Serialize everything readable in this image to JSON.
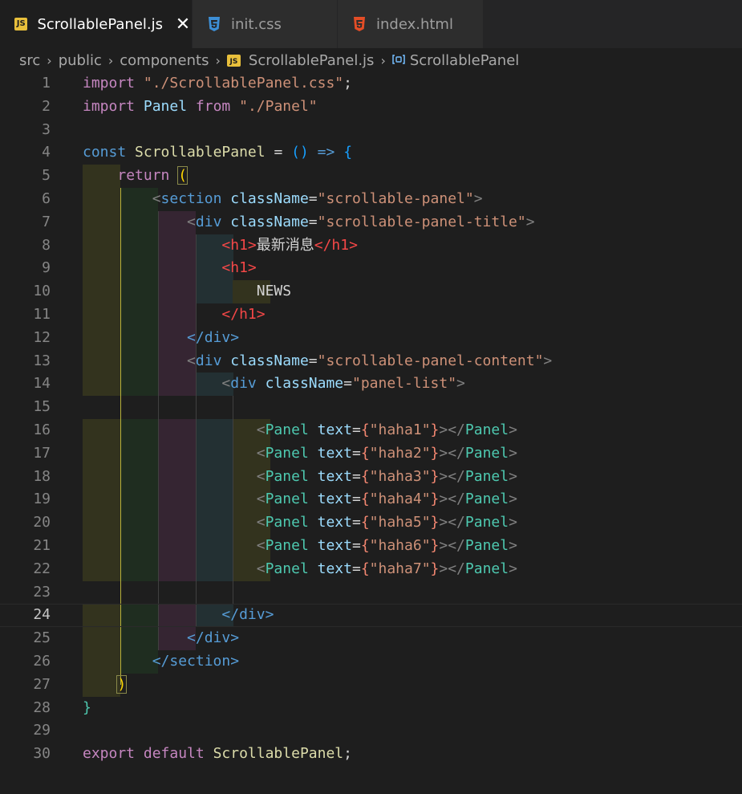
{
  "tabs": [
    {
      "label": "ScrollablePanel.js",
      "icon": "js-file-icon",
      "icon_text": "JS",
      "active": true,
      "close": "✕"
    },
    {
      "label": "init.css",
      "icon": "css-file-icon",
      "active": false
    },
    {
      "label": "index.html",
      "icon": "html-file-icon",
      "active": false
    }
  ],
  "breadcrumb": {
    "items": [
      "src",
      "public",
      "components"
    ],
    "file": "ScrollablePanel.js",
    "file_icon_text": "JS",
    "symbol": "ScrollablePanel",
    "sep": "›"
  },
  "editor": {
    "active_line": 24,
    "line_numbers": [
      "1",
      "2",
      "3",
      "4",
      "5",
      "6",
      "7",
      "8",
      "9",
      "10",
      "11",
      "12",
      "13",
      "14",
      "15",
      "16",
      "17",
      "18",
      "19",
      "20",
      "21",
      "22",
      "23",
      "24",
      "25",
      "26",
      "27",
      "28",
      "29",
      "30"
    ],
    "code": {
      "l1_kw": "import",
      "l1_str": "\"./ScrollablePanel.css\"",
      "l1_end": ";",
      "l2_kw": "import",
      "l2_id": "Panel",
      "l2_from": "from",
      "l2_str": "\"./Panel\"",
      "l4_const": "const",
      "l4_name": "ScrollablePanel",
      "l4_eq": "=",
      "l4_parens": "()",
      "l4_arrow": "=>",
      "l4_brace": "{",
      "l5_return": "return",
      "l5_paren": "(",
      "l6_open": "<",
      "l6_tag": "section",
      "l6_attr": "className",
      "l6_val": "\"scrollable-panel\"",
      "l6_close": ">",
      "l7_tag": "div",
      "l7_attr": "className",
      "l7_val": "\"scrollable-panel-title\"",
      "l8_open": "<h1>",
      "l8_text": "最新消息",
      "l8_close": "</h1>",
      "l9_open": "<h1>",
      "l10_text": "NEWS",
      "l11_close": "</h1>",
      "l12_close": "</div>",
      "l13_tag": "div",
      "l13_attr": "className",
      "l13_val": "\"scrollable-panel-content\"",
      "l14_tag": "div",
      "l14_attr": "className",
      "l14_val": "\"panel-list\"",
      "panels": [
        {
          "text": "\"haha1\""
        },
        {
          "text": "\"haha2\""
        },
        {
          "text": "\"haha3\""
        },
        {
          "text": "\"haha4\""
        },
        {
          "text": "\"haha5\""
        },
        {
          "text": "\"haha6\""
        },
        {
          "text": "\"haha7\""
        }
      ],
      "panel_tag": "Panel",
      "panel_attr": "text",
      "l24_close": "</div>",
      "l25_close": "</div>",
      "l26_close": "</section>",
      "l27_paren": ")",
      "l28_brace": "}",
      "l30_export": "export",
      "l30_default": "default",
      "l30_name": "ScrollablePanel",
      "l30_end": ";"
    }
  },
  "colors": {
    "editor_bg": "#1e1e1e",
    "tab_bar": "#252526",
    "keyword": "#c586c0",
    "string": "#ce9178",
    "tag": "#569cd6"
  }
}
